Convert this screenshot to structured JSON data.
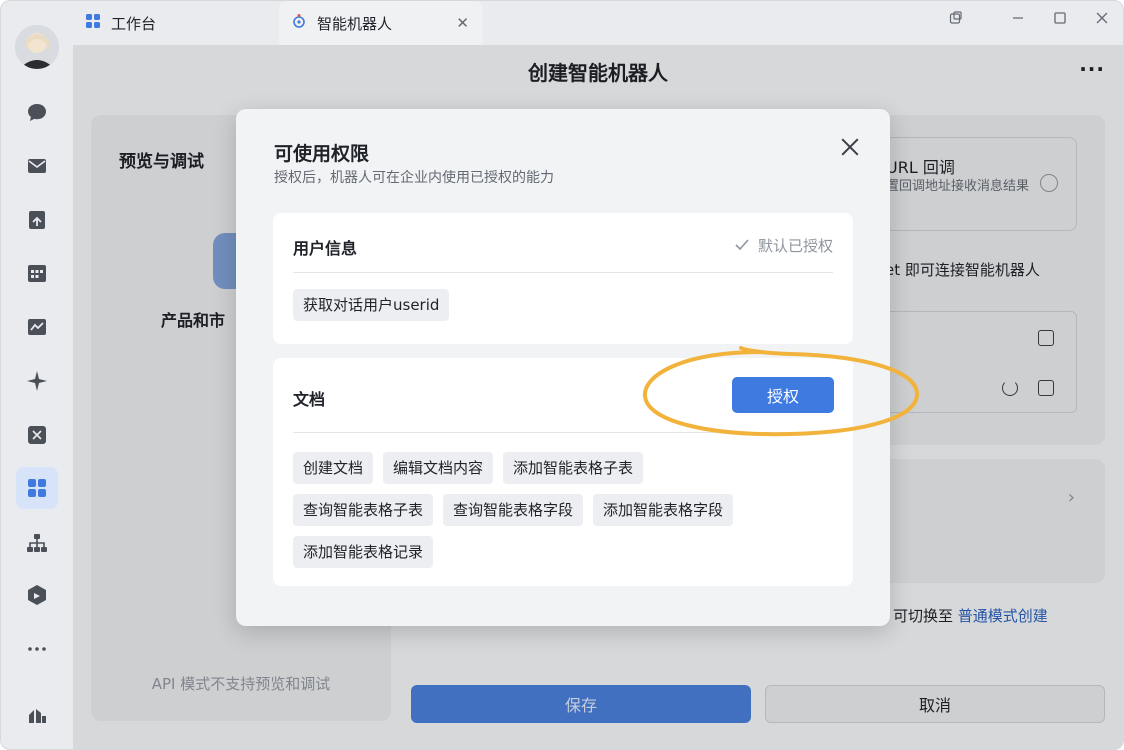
{
  "tabs": [
    {
      "label": "工作台",
      "icon": "grid-icon"
    },
    {
      "label": "智能机器人",
      "icon": "robot-icon"
    }
  ],
  "header": {
    "title": "创建智能机器人",
    "more": "···"
  },
  "left_panel": {
    "title": "预览与调试",
    "robot_name": "产品和市",
    "note": "API 模式不支持预览和调试"
  },
  "right_panel": {
    "url_card_title": "URL 回调",
    "url_card_desc": "置回调地址接收消息结果",
    "webhook_tip": "et 即可连接智能机器人"
  },
  "switch_tip": {
    "text": "可切换至",
    "link": "普通模式创建"
  },
  "actions": {
    "save": "保存",
    "cancel": "取消"
  },
  "modal": {
    "title": "可使用权限",
    "subtitle": "授权后，机器人可在企业内使用已授权的能力",
    "sections": [
      {
        "title": "用户信息",
        "status": "默认已授权",
        "chips": [
          "获取对话用户userid"
        ]
      },
      {
        "title": "文档",
        "button": "授权",
        "chips": [
          "创建文档",
          "编辑文档内容",
          "添加智能表格子表",
          "查询智能表格子表",
          "查询智能表格字段",
          "添加智能表格字段",
          "添加智能表格记录"
        ]
      }
    ]
  },
  "colors": {
    "accent": "#3f7ae0",
    "highlight_ring": "#f2b33d",
    "save_button": "#4a7dd6"
  }
}
